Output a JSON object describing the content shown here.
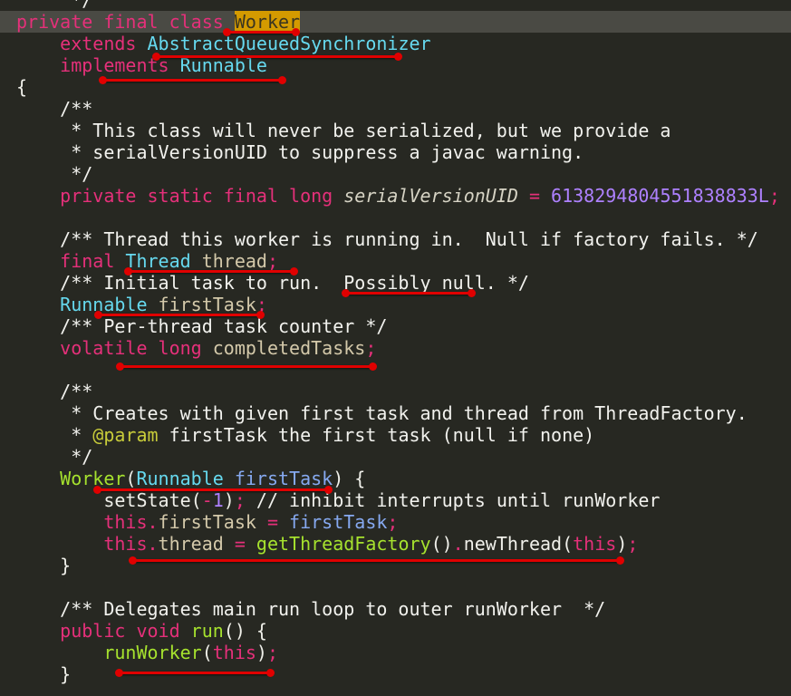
{
  "editor": {
    "current_line": 1,
    "colors": {
      "background": "#272822",
      "keyword": "#e5307a",
      "type": "#66d9ef",
      "number": "#ae81ff",
      "method": "#a6e22e",
      "annotation_underline": "#e00000",
      "search_highlight": "#d49a00"
    },
    "lines": [
      [
        [
          "c",
          "     */"
        ]
      ],
      [
        [
          "k",
          "private final class "
        ],
        [
          "hl",
          "Worker"
        ]
      ],
      [
        [
          "d",
          "    "
        ],
        [
          "k",
          "extends "
        ],
        [
          "t",
          "AbstractQueuedSynchronizer"
        ]
      ],
      [
        [
          "d",
          "    "
        ],
        [
          "k",
          "implements "
        ],
        [
          "t",
          "Runnable"
        ]
      ],
      [
        [
          "d",
          "{"
        ]
      ],
      [
        [
          "c",
          "    /**"
        ]
      ],
      [
        [
          "c",
          "     * This class will never be serialized, but we provide a"
        ]
      ],
      [
        [
          "c",
          "     * serialVersionUID to suppress a javac warning."
        ]
      ],
      [
        [
          "c",
          "     */"
        ]
      ],
      [
        [
          "d",
          "    "
        ],
        [
          "k",
          "private static final long "
        ],
        [
          "i",
          "serialVersionUID"
        ],
        [
          "k",
          " = "
        ],
        [
          "n",
          "6138294804551838833L"
        ],
        [
          "k",
          ";"
        ]
      ],
      [
        [
          "d",
          ""
        ]
      ],
      [
        [
          "c",
          "    /** Thread this worker is running in.  Null if factory fails. */"
        ]
      ],
      [
        [
          "d",
          "    "
        ],
        [
          "k",
          "final "
        ],
        [
          "t",
          "Thread "
        ],
        [
          "f",
          "thread"
        ],
        [
          "k",
          ";"
        ]
      ],
      [
        [
          "c",
          "    /** Initial task to run.  Possibly null. */"
        ]
      ],
      [
        [
          "d",
          "    "
        ],
        [
          "t",
          "Runnable "
        ],
        [
          "f",
          "firstTask"
        ],
        [
          "k",
          ";"
        ]
      ],
      [
        [
          "c",
          "    /** Per-thread task counter */"
        ]
      ],
      [
        [
          "d",
          "    "
        ],
        [
          "k",
          "volatile long "
        ],
        [
          "f",
          "completedTasks"
        ],
        [
          "k",
          ";"
        ]
      ],
      [
        [
          "d",
          ""
        ]
      ],
      [
        [
          "c",
          "    /**"
        ]
      ],
      [
        [
          "c",
          "     * Creates with given first task and thread from ThreadFactory."
        ]
      ],
      [
        [
          "c",
          "     * "
        ],
        [
          "a",
          "@param"
        ],
        [
          "c",
          " firstTask the first task (null if none)"
        ]
      ],
      [
        [
          "c",
          "     */"
        ]
      ],
      [
        [
          "d",
          "    "
        ],
        [
          "m",
          "Worker"
        ],
        [
          "d",
          "("
        ],
        [
          "t",
          "Runnable "
        ],
        [
          "p",
          "firstTask"
        ],
        [
          "d",
          ") {"
        ]
      ],
      [
        [
          "d",
          "        setState("
        ],
        [
          "k",
          "-"
        ],
        [
          "n",
          "1"
        ],
        [
          "d",
          ")"
        ],
        [
          "k",
          ";"
        ],
        [
          "c",
          " // inhibit interrupts until runWorker"
        ]
      ],
      [
        [
          "d",
          "        "
        ],
        [
          "k",
          "this."
        ],
        [
          "f",
          "firstTask"
        ],
        [
          "k",
          " = "
        ],
        [
          "p",
          "firstTask"
        ],
        [
          "k",
          ";"
        ]
      ],
      [
        [
          "d",
          "        "
        ],
        [
          "k",
          "this."
        ],
        [
          "f",
          "thread"
        ],
        [
          "k",
          " = "
        ],
        [
          "m",
          "getThreadFactory"
        ],
        [
          "d",
          "()"
        ],
        [
          "k",
          "."
        ],
        [
          "d",
          "newThread("
        ],
        [
          "k",
          "this"
        ],
        [
          "d",
          ")"
        ],
        [
          "k",
          ";"
        ]
      ],
      [
        [
          "d",
          "    }"
        ]
      ],
      [
        [
          "d",
          ""
        ]
      ],
      [
        [
          "c",
          "    /** Delegates main run loop to outer runWorker  */"
        ]
      ],
      [
        [
          "d",
          "    "
        ],
        [
          "k",
          "public void "
        ],
        [
          "m",
          "run"
        ],
        [
          "d",
          "() {"
        ]
      ],
      [
        [
          "d",
          "        "
        ],
        [
          "m",
          "runWorker"
        ],
        [
          "d",
          "("
        ],
        [
          "k",
          "this"
        ],
        [
          "d",
          ")"
        ],
        [
          "k",
          ";"
        ]
      ],
      [
        [
          "d",
          "    }"
        ]
      ]
    ]
  }
}
